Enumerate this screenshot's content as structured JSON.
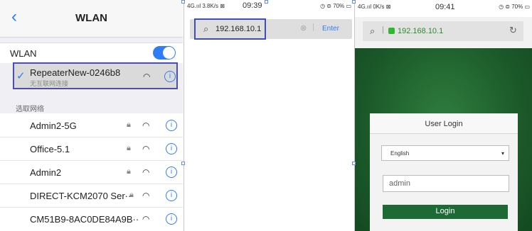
{
  "wlan_settings": {
    "nav_title": "WLAN",
    "back_icon": "chevron-left-icon",
    "wlan_label": "WLAN",
    "wlan_enabled": true,
    "connected": {
      "ssid": "RepeaterNew-0246b8",
      "status": "无互联网连接",
      "info": "i"
    },
    "section_header": "选取网络",
    "networks": [
      {
        "name": "Admin2-5G",
        "locked": true,
        "info": "i"
      },
      {
        "name": "Office-5.1",
        "locked": true,
        "info": "i"
      },
      {
        "name": "Admin2",
        "locked": true,
        "info": "i"
      },
      {
        "name": "DIRECT-KCM2070 Ser··",
        "locked": true,
        "info": "i"
      },
      {
        "name": "CM51B9-8AC0DE84A9B··",
        "locked": false,
        "info": "i"
      }
    ],
    "accent_color": "#2f7cf6"
  },
  "browser_entry": {
    "status": {
      "left": "4G.ııl 3.8K/s ⊠",
      "time": "09:39",
      "right": "◷ ⊜ 70% ▭"
    },
    "url_value": "192.168.10.1",
    "enter_label": "Enter",
    "highlight_color": "#3f4fb8"
  },
  "router_login": {
    "status": {
      "left": "4G.ııl 0K/s ⊠",
      "time": "09:41",
      "right": "◷ ⊜ 70% ▭"
    },
    "url_value": "192.168.10.1",
    "card_title": "User Login",
    "language": "English",
    "username_value": "admin",
    "login_label": "Login",
    "brand_color": "#1e6a35"
  }
}
